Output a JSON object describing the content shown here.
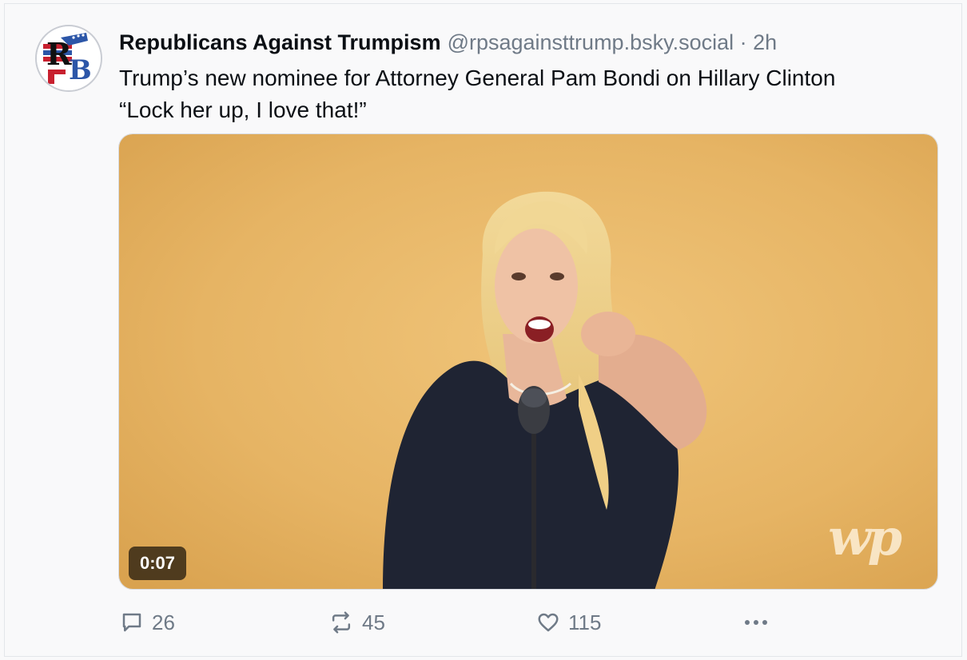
{
  "post": {
    "author": "Republicans Against Trumpism",
    "avatar_text": "RB",
    "handle": "@rpsagainsttrump.bsky.social",
    "separator": "·",
    "time": "2h",
    "text_line1": "Trump’s new nominee for Attorney General Pam Bondi on Hillary Clinton",
    "text_line2": "“Lock her up, I love that!”"
  },
  "media": {
    "type": "video",
    "duration": "0:07",
    "watermark": "wp",
    "colors": {
      "background": "#e7b564",
      "dress": "#1f2433",
      "hair": "#e9cb86"
    }
  },
  "actions": {
    "replies": "26",
    "reposts": "45",
    "likes": "115",
    "icons": [
      "comment-icon",
      "repost-icon",
      "heart-icon",
      "more-icon"
    ]
  },
  "colors": {
    "muted": "#6f7a87",
    "text": "#0b0f14",
    "page": "#f9f9fa"
  }
}
